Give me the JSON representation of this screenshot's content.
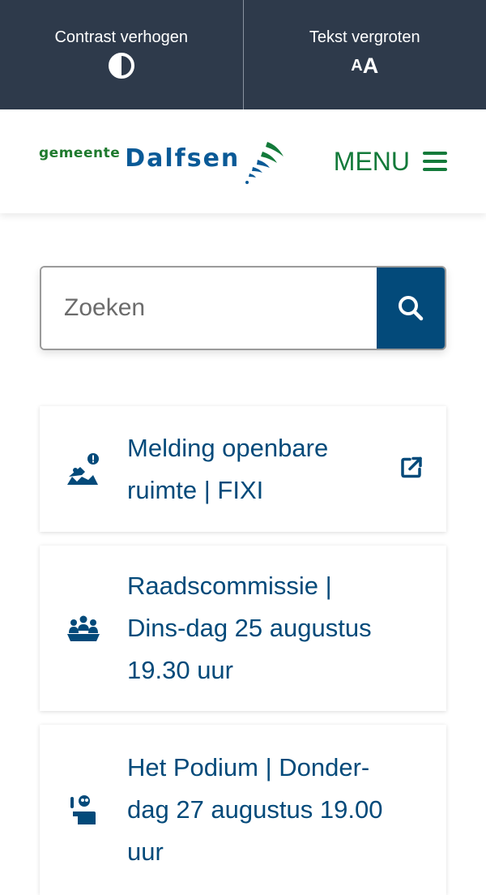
{
  "topbar": {
    "contrast_label": "Contrast verhogen",
    "text_size_label": "Tekst vergroten",
    "text_size_icon_small": "A",
    "text_size_icon_big": "A"
  },
  "header": {
    "logo_small": "gemeente",
    "logo_big": "Dalfsen",
    "menu_label": "MENU"
  },
  "search": {
    "placeholder": "Zoeken"
  },
  "cards": [
    {
      "label": "Melding openbare ruimte | FIXI",
      "icon": "report-issue-icon",
      "external": true
    },
    {
      "label": "Raadscommissie | Dins-dag 25 augustus 19.30 uur",
      "icon": "meeting-icon",
      "external": false
    },
    {
      "label": "Het Podium | Donder-dag 27 augustus 19.00 uur",
      "icon": "speaker-icon",
      "external": false
    }
  ],
  "colors": {
    "topbar_bg": "#2e3a4b",
    "primary_blue": "#034a7a",
    "brand_green": "#137a3a"
  }
}
